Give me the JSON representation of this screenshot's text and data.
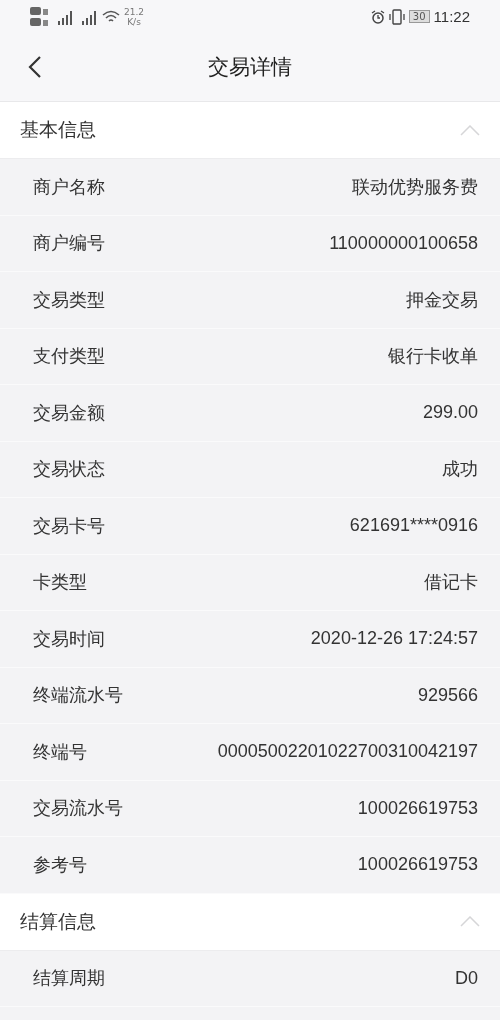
{
  "status_bar": {
    "speed": "21.2",
    "speed_unit": "K/s",
    "battery": "30",
    "time": "11:22"
  },
  "header": {
    "title": "交易详情"
  },
  "sections": [
    {
      "title": "基本信息",
      "expanded": true,
      "rows": [
        {
          "label": "商户名称",
          "value": "联动优势服务费"
        },
        {
          "label": "商户编号",
          "value": "110000000100658"
        },
        {
          "label": "交易类型",
          "value": "押金交易"
        },
        {
          "label": "支付类型",
          "value": "银行卡收单"
        },
        {
          "label": "交易金额",
          "value": "299.00"
        },
        {
          "label": "交易状态",
          "value": "成功"
        },
        {
          "label": "交易卡号",
          "value": "621691****0916"
        },
        {
          "label": "卡类型",
          "value": "借记卡"
        },
        {
          "label": "交易时间",
          "value": "2020-12-26 17:24:57"
        },
        {
          "label": "终端流水号",
          "value": "929566"
        },
        {
          "label": "终端号",
          "value": "00005002201022700310042197"
        },
        {
          "label": "交易流水号",
          "value": "100026619753"
        },
        {
          "label": "参考号",
          "value": "100026619753"
        }
      ]
    },
    {
      "title": "结算信息",
      "expanded": true,
      "rows": [
        {
          "label": "结算周期",
          "value": "D0"
        }
      ]
    }
  ]
}
